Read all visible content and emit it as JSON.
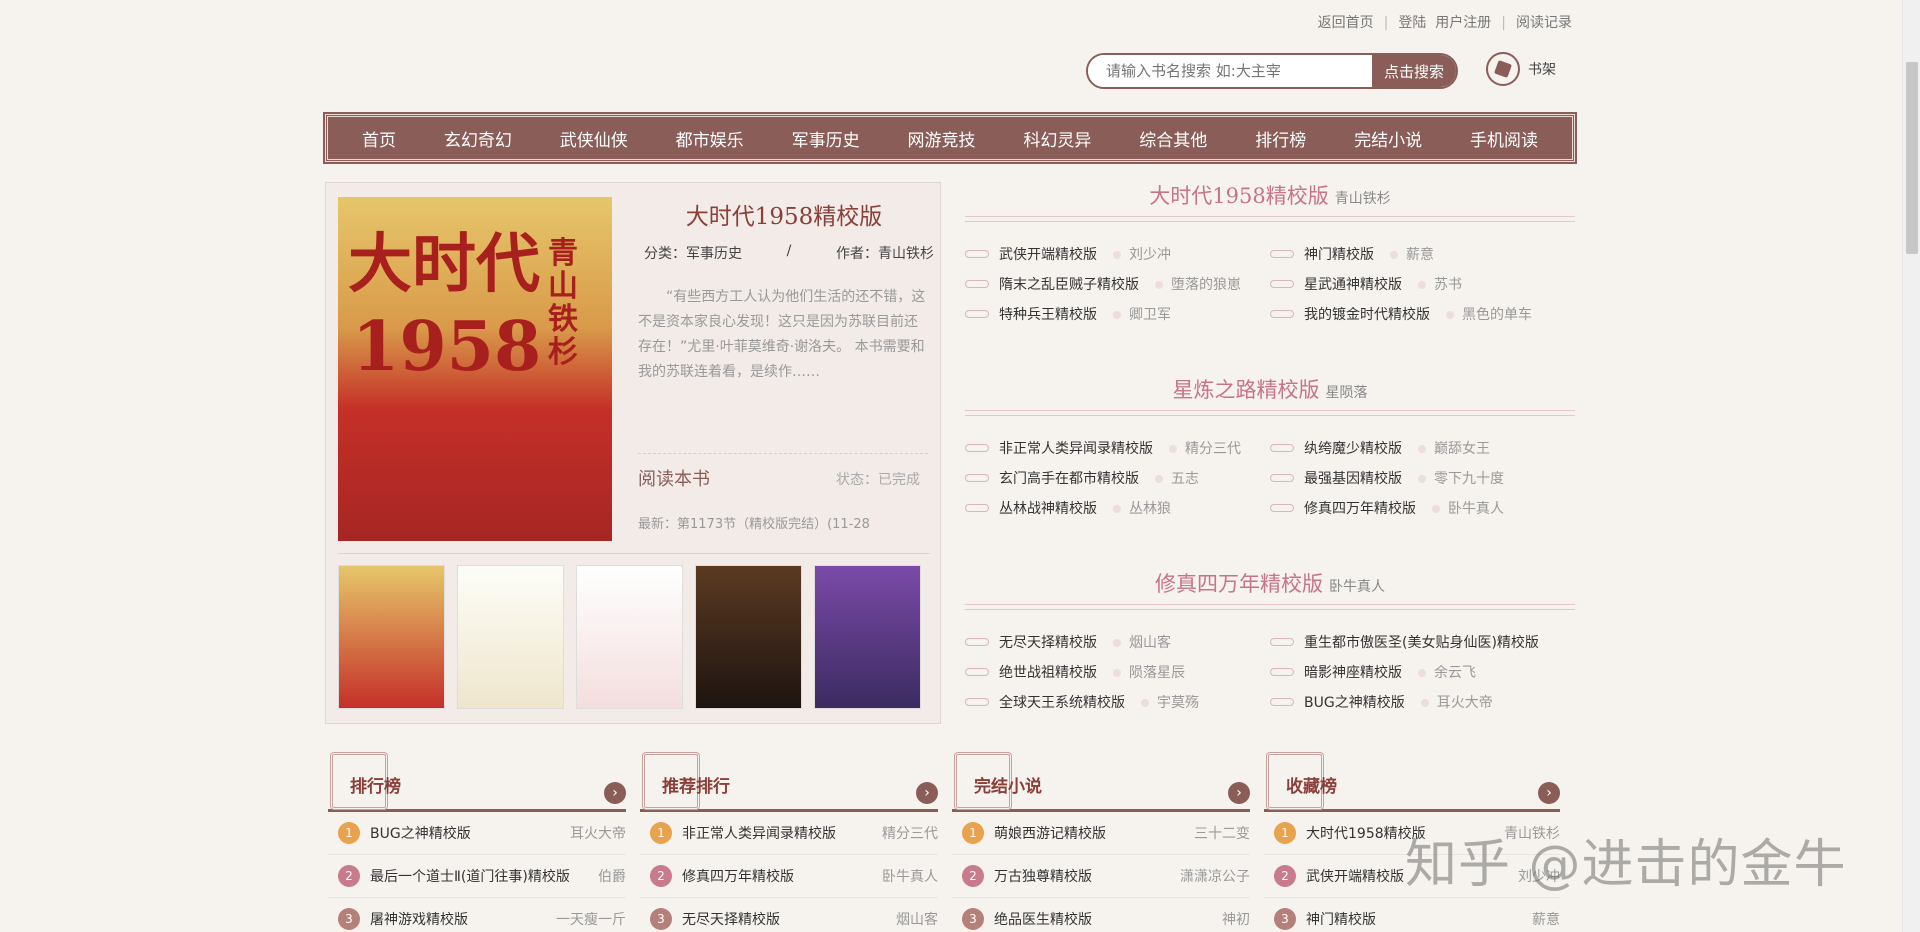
{
  "toplinks": {
    "home": "返回首页",
    "login": "登陆",
    "register": "用户注册",
    "history": "阅读记录",
    "sep": "|"
  },
  "search": {
    "placeholder": "请输入书名搜索 如:大主宰",
    "button": "点击搜索"
  },
  "shelf": {
    "label": "书架",
    "icon": "bookshelf-icon"
  },
  "nav": [
    "首页",
    "玄幻奇幻",
    "武侠仙侠",
    "都市娱乐",
    "军事历史",
    "网游竞技",
    "科幻灵异",
    "综合其他",
    "排行榜",
    "完结小说",
    "手机阅读"
  ],
  "feature": {
    "title": "大时代1958精校版",
    "category": "分类：军事历史",
    "slash": "/",
    "author": "作者：青山铁杉",
    "desc": "“有些西方工人认为他们生活的还不错，这不是资本家良心发现！这只是因为苏联目前还存在！”尤里·叶菲莫维奇·谢洛夫。 本书需要和我的苏联连着看，是续作……",
    "read": "阅读本书",
    "status": "状态：已完成",
    "latest": "最新：第1173节（精校版完结）(11-28",
    "cover_title": "大时代",
    "cover_number": "1958",
    "cover_author": "青山铁杉"
  },
  "sections": [
    {
      "title": "大时代1958精校版",
      "author": "青山铁杉",
      "items": [
        {
          "book": "武侠开端精校版",
          "author": "刘少冲"
        },
        {
          "book": "神门精校版",
          "author": "薪意"
        },
        {
          "book": "隋末之乱臣贼子精校版",
          "author": "堕落的狼崽"
        },
        {
          "book": "星武通神精校版",
          "author": "苏书"
        },
        {
          "book": "特种兵王精校版",
          "author": "卿卫军"
        },
        {
          "book": "我的镀金时代精校版",
          "author": "黑色的单车"
        }
      ]
    },
    {
      "title": "星炼之路精校版",
      "author": "星陨落",
      "items": [
        {
          "book": "非正常人类异闻录精校版",
          "author": "精分三代"
        },
        {
          "book": "纨绔魔少精校版",
          "author": "巅舔女王"
        },
        {
          "book": "玄门高手在都市精校版",
          "author": "五志"
        },
        {
          "book": "最强基因精校版",
          "author": "零下九十度"
        },
        {
          "book": "丛林战神精校版",
          "author": "丛林狼"
        },
        {
          "book": "修真四万年精校版",
          "author": "卧牛真人"
        }
      ]
    },
    {
      "title": "修真四万年精校版",
      "author": "卧牛真人",
      "items": [
        {
          "book": "无尽天择精校版",
          "author": "烟山客"
        },
        {
          "book": "重生都市傲医圣(美女贴身仙医)精校版",
          "author": ""
        },
        {
          "book": "绝世战祖精校版",
          "author": "陨落星辰"
        },
        {
          "book": "暗影神座精校版",
          "author": "余云飞"
        },
        {
          "book": "全球天王系统精校版",
          "author": "宇莫殇"
        },
        {
          "book": "BUG之神精校版",
          "author": "耳火大帝"
        }
      ]
    }
  ],
  "rankings": [
    {
      "title": "排行榜",
      "items": [
        {
          "no": "1",
          "book": "BUG之神精校版",
          "author": "耳火大帝"
        },
        {
          "no": "2",
          "book": "最后一个道士Ⅱ(道门往事)精校版",
          "author": "伯爵"
        },
        {
          "no": "3",
          "book": "屠神游戏精校版",
          "author": "一天瘦一斤"
        }
      ]
    },
    {
      "title": "推荐排行",
      "items": [
        {
          "no": "1",
          "book": "非正常人类异闻录精校版",
          "author": "精分三代"
        },
        {
          "no": "2",
          "book": "修真四万年精校版",
          "author": "卧牛真人"
        },
        {
          "no": "3",
          "book": "无尽天择精校版",
          "author": "烟山客"
        }
      ]
    },
    {
      "title": "完结小说",
      "items": [
        {
          "no": "1",
          "book": "萌娘西游记精校版",
          "author": "三十二变"
        },
        {
          "no": "2",
          "book": "万古独尊精校版",
          "author": "潇潇凉公子"
        },
        {
          "no": "3",
          "book": "绝品医生精校版",
          "author": "神初"
        }
      ]
    },
    {
      "title": "收藏榜",
      "items": [
        {
          "no": "1",
          "book": "大时代1958精校版",
          "author": "青山铁杉"
        },
        {
          "no": "2",
          "book": "武侠开端精校版",
          "author": "刘少冲"
        },
        {
          "no": "3",
          "book": "神门精校版",
          "author": "薪意"
        }
      ]
    }
  ],
  "more_glyph": "›",
  "watermark": "知乎 @进击的金牛",
  "colors": {
    "accent": "#8a5d58",
    "pink": "#c7738a",
    "rank1": "#e9a24e",
    "rank2": "#c97b8b",
    "rank3": "#b48078"
  }
}
